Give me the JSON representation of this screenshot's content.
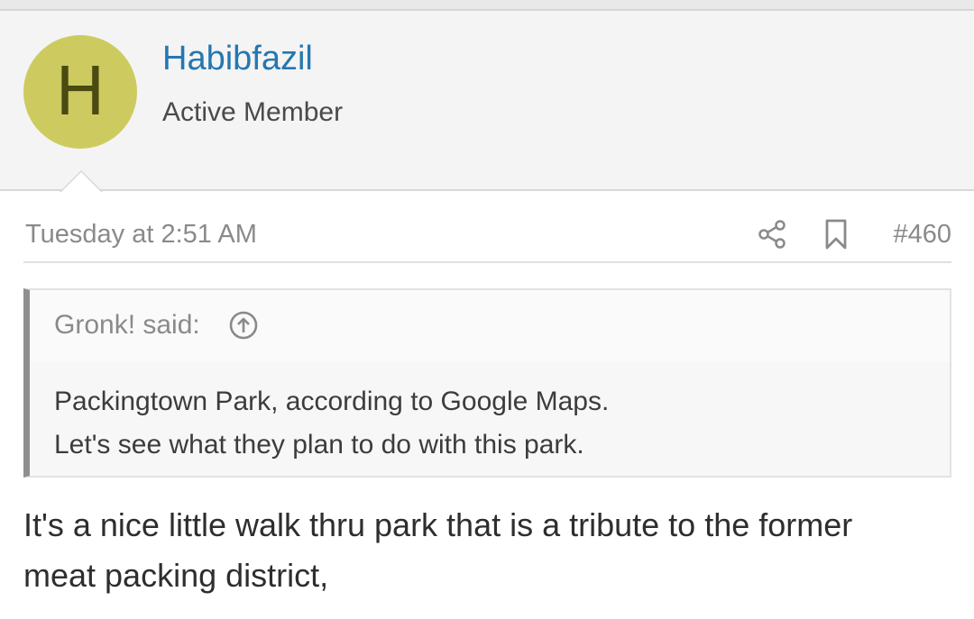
{
  "user": {
    "avatar_letter": "H",
    "avatar_color": "#cdcb5f",
    "name": "Habibfazil",
    "title": "Active Member",
    "name_color": "#2577b1"
  },
  "post": {
    "date": "Tuesday at 2:51 AM",
    "number": "#460",
    "share_icon": "share-icon",
    "bookmark_icon": "bookmark-icon"
  },
  "quote": {
    "author_label": "Gronk! said:",
    "jump_icon": "arrow-up-circle-icon",
    "lines": [
      "Packingtown Park, according to Google Maps.",
      "Let's see what they plan to do with this park."
    ]
  },
  "message": {
    "lines": [
      "It's a nice little walk thru park that is a tribute to the former",
      "meat packing district,"
    ]
  }
}
